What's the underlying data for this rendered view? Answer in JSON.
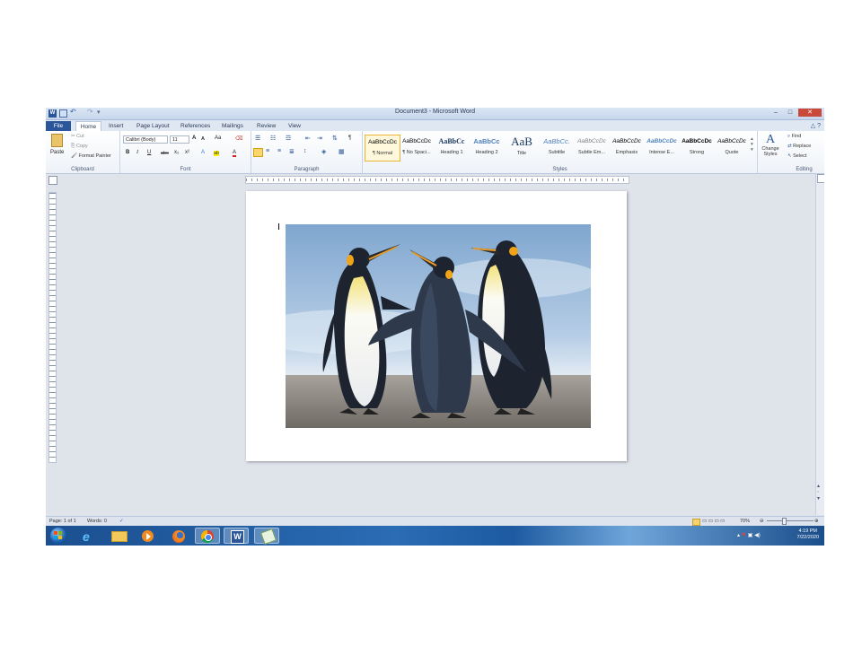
{
  "window": {
    "title": "Document3 - Microsoft Word",
    "qat": {
      "logo": "W",
      "undo": "↶",
      "redo": "↷",
      "customize": "▾"
    },
    "controls": {
      "minimize": "–",
      "maximize": "□",
      "close": "✕"
    }
  },
  "tabs": [
    "File",
    "Home",
    "Insert",
    "Page Layout",
    "References",
    "Mailings",
    "Review",
    "View"
  ],
  "help": "△ ?",
  "ribbon": {
    "clipboard": {
      "label": "Clipboard",
      "paste": "Paste",
      "cut": "Cut",
      "copy": "Copy",
      "format_painter": "Format Painter"
    },
    "font": {
      "label": "Font",
      "family": "Calibri (Body)",
      "size": "11",
      "grow": "A",
      "shrink": "A",
      "case": "Aa",
      "clear": "⌫",
      "bold": "B",
      "italic": "I",
      "underline": "U",
      "strike": "abc",
      "subscript": "x₂",
      "superscript": "x²",
      "effects": "A",
      "highlight": "ab",
      "color": "A"
    },
    "paragraph": {
      "label": "Paragraph",
      "pilcrow": "¶"
    },
    "styles": {
      "label": "Styles",
      "items": [
        {
          "preview": "AaBbCcDc",
          "name": "¶ Normal"
        },
        {
          "preview": "AaBbCcDc",
          "name": "¶ No Spaci..."
        },
        {
          "preview": "AaBbCc",
          "name": "Heading 1"
        },
        {
          "preview": "AaBbCc",
          "name": "Heading 2"
        },
        {
          "preview": "AaB",
          "name": "Title"
        },
        {
          "preview": "AaBbCc.",
          "name": "Subtitle"
        },
        {
          "preview": "AaBbCcDc",
          "name": "Subtle Em..."
        },
        {
          "preview": "AaBbCcDc",
          "name": "Emphasis"
        },
        {
          "preview": "AaBbCcDc",
          "name": "Intense E..."
        },
        {
          "preview": "AaBbCcDc",
          "name": "Strong"
        },
        {
          "preview": "AaBbCcDc",
          "name": "Quote"
        }
      ],
      "change_styles": "Change Styles"
    },
    "editing": {
      "label": "Editing",
      "find": "Find",
      "replace": "Replace",
      "select": "Select"
    }
  },
  "status": {
    "page": "Page: 1 of 1",
    "words": "Words: 0",
    "zoom": "70%"
  },
  "taskbar": {
    "time": "4:19 PM",
    "date": "7/22/2020"
  },
  "colors": {
    "word_blue": "#2b579a",
    "taskbar": "#1d5aa0",
    "sky": "#a9c8e6",
    "ground": "#8c8680"
  },
  "icons": [
    "windows-start-icon",
    "ie-icon",
    "folder-icon",
    "media-player-icon",
    "firefox-icon",
    "chrome-icon",
    "word-icon",
    "app-icon"
  ]
}
